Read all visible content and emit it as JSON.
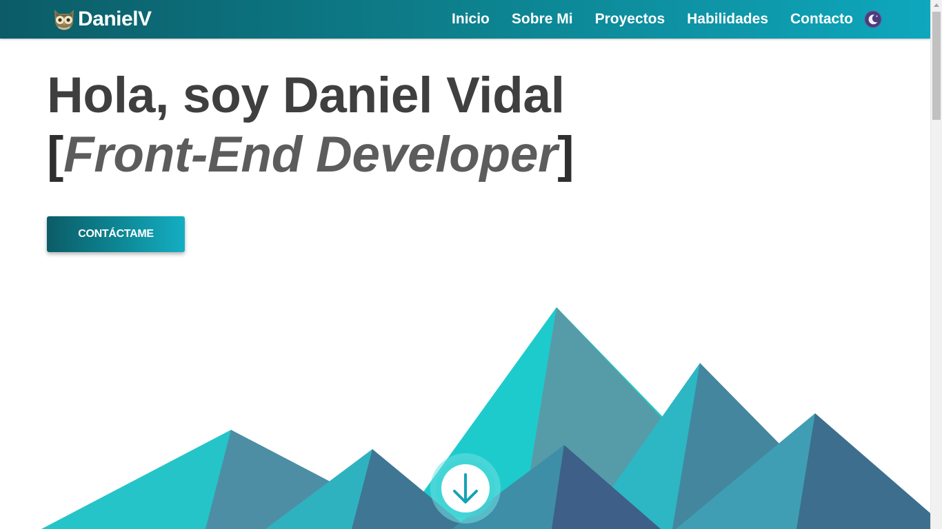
{
  "header": {
    "brand": {
      "name": "DanielV",
      "logo_icon": "owl-logo-icon"
    },
    "nav": {
      "items": [
        {
          "label": "Inicio"
        },
        {
          "label": "Sobre Mi"
        },
        {
          "label": "Proyectos"
        },
        {
          "label": "Habilidades"
        },
        {
          "label": "Contacto"
        }
      ],
      "theme_toggle_icon": "moon-icon"
    }
  },
  "hero": {
    "title_line1": "Hola, soy Daniel Vidal",
    "bracket_open": "[",
    "role": "Front-End Developer",
    "bracket_close": "]",
    "cta_label": "CONTÁCTAME"
  },
  "scroll_down": {
    "icon": "arrow-down-icon"
  },
  "colors": {
    "header_gradient_start": "#0b5c67",
    "header_gradient_end": "#0ea7bd",
    "title_text": "#3f3f3f",
    "role_text": "#5c5c5c",
    "mountain_teal": "#1ecbcc",
    "mountain_slate": "#3f6289"
  }
}
